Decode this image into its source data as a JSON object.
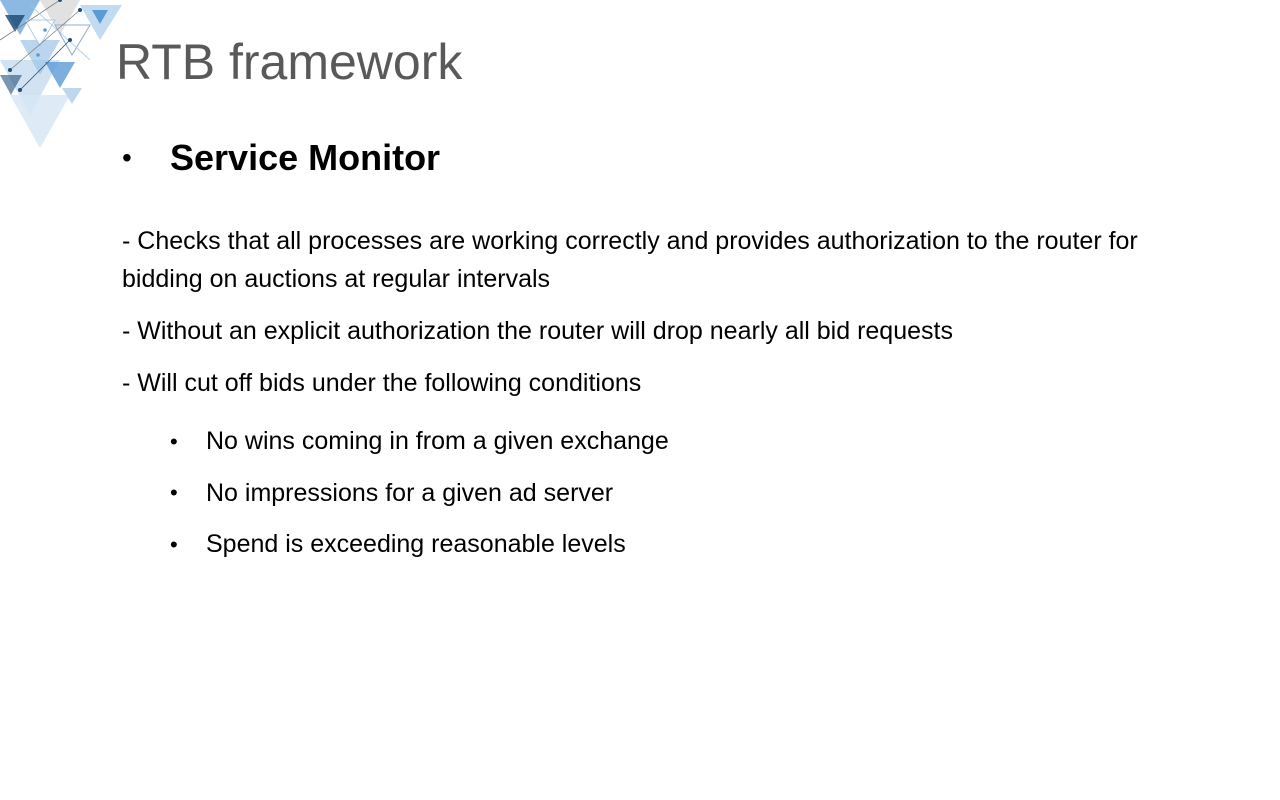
{
  "slide": {
    "title": "RTB framework",
    "heading": "Service Monitor",
    "bullet_char": "•",
    "paragraphs": [
      " - Checks that all processes are working correctly and provides authorization to the router for bidding on auctions at regular intervals",
      " - Without an explicit authorization the router will drop nearly all bid requests",
      " - Will cut off bids under the following conditions"
    ],
    "conditions": [
      "No wins coming in from a given exchange",
      "No impressions for a given ad server",
      "Spend is exceeding reasonable levels"
    ]
  },
  "colors": {
    "title": "#595959",
    "text": "#000000",
    "deco_dark": "#1f4e79",
    "deco_mid": "#5b9bd5",
    "deco_light": "#bdd7ee"
  }
}
